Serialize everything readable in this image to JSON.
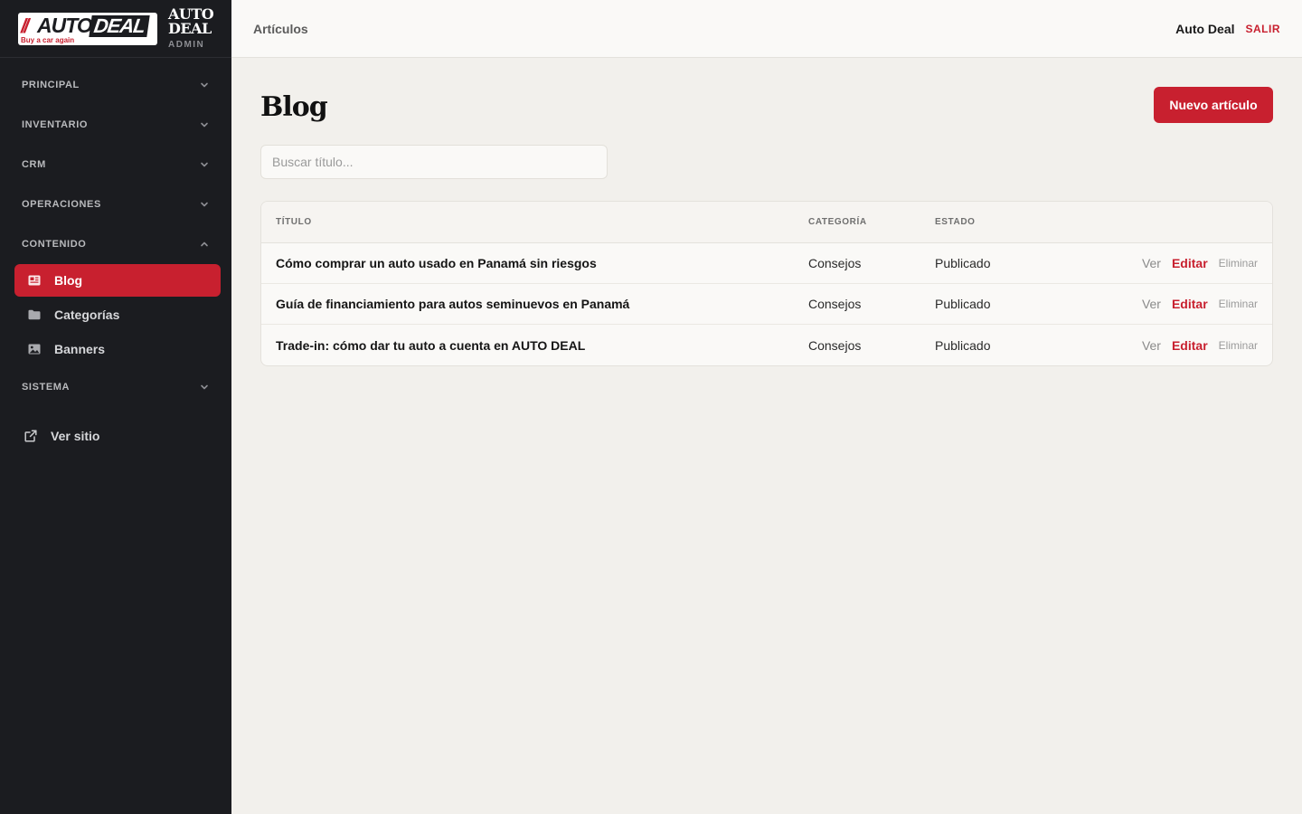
{
  "brand": {
    "logo_slash": "//",
    "logo_auto": "AUTO",
    "logo_deal": "DEAL",
    "logo_tagline": "Buy a car again",
    "name_line1": "AUTO",
    "name_line2": "DEAL",
    "sub": "ADMIN"
  },
  "sidebar": {
    "sections": [
      {
        "label": "PRINCIPAL",
        "expanded": false
      },
      {
        "label": "INVENTARIO",
        "expanded": false
      },
      {
        "label": "CRM",
        "expanded": false
      },
      {
        "label": "OPERACIONES",
        "expanded": false
      },
      {
        "label": "CONTENIDO",
        "expanded": true
      },
      {
        "label": "SISTEMA",
        "expanded": false
      }
    ],
    "contenido_items": [
      {
        "label": "Blog",
        "icon": "newspaper-icon",
        "active": true
      },
      {
        "label": "Categorías",
        "icon": "folder-icon",
        "active": false
      },
      {
        "label": "Banners",
        "icon": "image-icon",
        "active": false
      }
    ],
    "ver_sitio": {
      "label": "Ver sitio",
      "icon": "external-link-icon"
    }
  },
  "topbar": {
    "breadcrumb": "Artículos",
    "user_name": "Auto Deal",
    "logout_label": "SALIR"
  },
  "main": {
    "title": "Blog",
    "new_button_label": "Nuevo artículo",
    "search_placeholder": "Buscar título...",
    "table": {
      "headers": {
        "title": "TÍTULO",
        "category": "CATEGORÍA",
        "state": "ESTADO"
      },
      "rows": [
        {
          "title": "Cómo comprar un auto usado en Panamá sin riesgos",
          "category": "Consejos",
          "state": "Publicado",
          "view": "Ver",
          "edit": "Editar",
          "delete": "Eliminar"
        },
        {
          "title": "Guía de financiamiento para autos seminuevos en Panamá",
          "category": "Consejos",
          "state": "Publicado",
          "view": "Ver",
          "edit": "Editar",
          "delete": "Eliminar"
        },
        {
          "title": "Trade-in: cómo dar tu auto a cuenta en AUTO DEAL",
          "category": "Consejos",
          "state": "Publicado",
          "view": "Ver",
          "edit": "Editar",
          "delete": "Eliminar"
        }
      ]
    }
  },
  "colors": {
    "accent": "#c8202f",
    "sidebar_bg": "#1b1c20",
    "page_bg": "#f2f0ec"
  }
}
